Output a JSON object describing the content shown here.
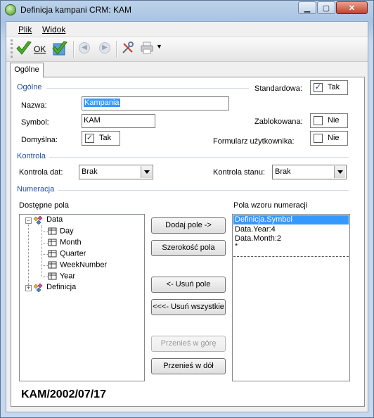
{
  "window": {
    "title": "Definicja kampani CRM: KAM"
  },
  "menu": [
    {
      "label": "Plik"
    },
    {
      "label": "Widok"
    }
  ],
  "toolbar": {
    "ok_label": "OK"
  },
  "tabs": [
    {
      "label": "Ogólne"
    }
  ],
  "groups": {
    "general": "Ogólne",
    "control": "Kontrola",
    "numbering": "Numeracja"
  },
  "form": {
    "name_label": "Nazwa:",
    "name_value": "Kampania",
    "symbol_label": "Symbol:",
    "symbol_value": "KAM",
    "default_label": "Domyślna:",
    "default_check": "Tak",
    "standard_label": "Standardowa:",
    "standard_check": "Tak",
    "blocked_label": "Zablokowana:",
    "blocked_check": "Nie",
    "userform_label": "Formularz użytkownika:",
    "userform_check": "Nie"
  },
  "control": {
    "date_label": "Kontrola dat:",
    "date_value": "Brak",
    "state_label": "Kontrola stanu:",
    "state_value": "Brak"
  },
  "numbering": {
    "available_label": "Dostępne pola",
    "pattern_label": "Pola wzoru numeracji",
    "tree": {
      "data": "Data",
      "children": [
        "Day",
        "Month",
        "Quarter",
        "WeekNumber",
        "Year"
      ],
      "definition": "Definicja"
    },
    "pattern_items": [
      "Definicja.Symbol",
      "Data.Year:4",
      "Data.Month:2",
      "*"
    ],
    "buttons": {
      "add": "Dodaj pole ->",
      "width": "Szerokość pola",
      "remove": "<- Usuń pole",
      "remove_all": "<<<- Usuń wszystkie",
      "up": "Przenieś w górę",
      "down": "Przenieś w dół"
    },
    "preview": "KAM/2002/07/17"
  },
  "colors": {
    "accent_blue": "#1d4e9c",
    "selection": "#3399ff",
    "ok_green": "#4caf2a"
  }
}
